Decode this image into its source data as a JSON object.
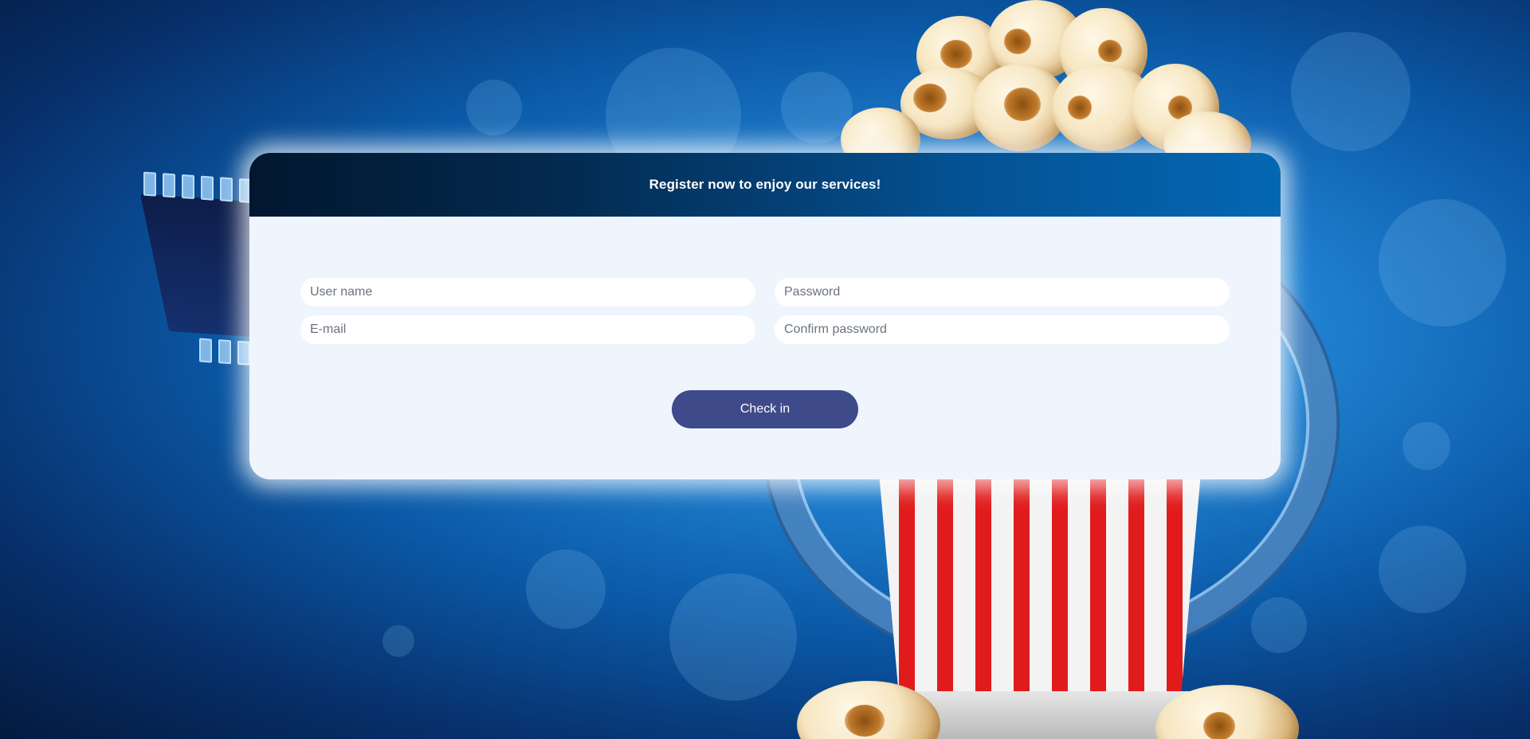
{
  "header": {
    "title": "Register now to enjoy our services!"
  },
  "form": {
    "username_placeholder": "User name",
    "password_placeholder": "Password",
    "email_placeholder": "E-mail",
    "confirm_password_placeholder": "Confirm password",
    "submit_label": "Check in"
  },
  "colors": {
    "header_start": "#02172f",
    "header_end": "#0467b3",
    "card_background": "#eef5fd",
    "button": "#3e4a8a",
    "background": "#0b5aa8"
  },
  "background_image": "popcorn-and-film-reel"
}
